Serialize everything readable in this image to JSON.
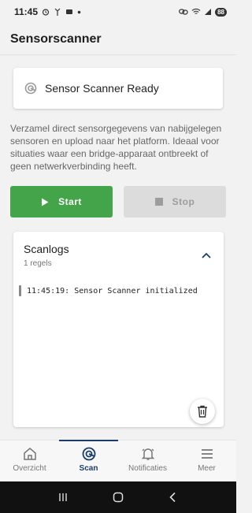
{
  "status_bar": {
    "time": "11:45",
    "battery": "88"
  },
  "app_bar": {
    "title": "Sensorscanner"
  },
  "status_card": {
    "text": "Sensor Scanner Ready"
  },
  "description": "Verzamel direct sensorgegevens van nabijgelegen sensoren en upload naar het platform. Ideaal voor situaties waar een bridge-apparaat ontbreekt of geen netwerkverbinding heeft.",
  "buttons": {
    "start": "Start",
    "stop": "Stop"
  },
  "log": {
    "title": "Scanlogs",
    "count": "1 regels",
    "entries": [
      "11:45:19: Sensor Scanner initialized"
    ]
  },
  "nav": {
    "items": [
      {
        "label": "Overzicht",
        "icon": "home-icon"
      },
      {
        "label": "Scan",
        "icon": "scan-icon"
      },
      {
        "label": "Notificaties",
        "icon": "bell-icon"
      },
      {
        "label": "Meer",
        "icon": "menu-icon"
      }
    ],
    "active": "Scan"
  },
  "colors": {
    "accent": "#43a44a",
    "nav_active": "#1c3d6b",
    "disabled": "#dcdcdc"
  }
}
